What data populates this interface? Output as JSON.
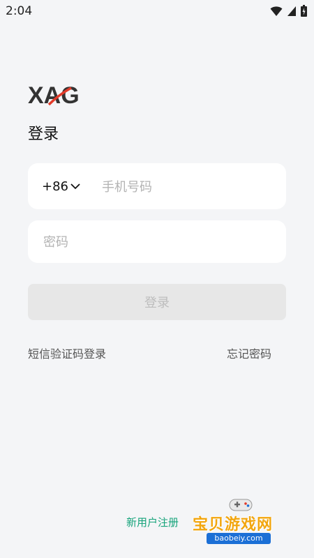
{
  "status_bar": {
    "time": "2:04",
    "icons": [
      "wifi-icon",
      "signal-icon",
      "battery-icon"
    ]
  },
  "logo": {
    "text": "XAG"
  },
  "title": "登录",
  "phone_field": {
    "country_code": "+86",
    "placeholder": "手机号码",
    "value": ""
  },
  "password_field": {
    "placeholder": "密码",
    "value": ""
  },
  "login_button": {
    "label": "登录",
    "enabled": false
  },
  "links": {
    "sms_login": "短信验证码登录",
    "forgot_password": "忘记密码",
    "register": "新用户注册"
  },
  "watermark": {
    "name": "宝贝游戏网",
    "url": "baobeiy.com"
  },
  "colors": {
    "background": "#f4f5f7",
    "accent": "#15a37a",
    "field_bg": "#ffffff",
    "button_disabled_bg": "#e7e7e7",
    "button_disabled_text": "#bdbdbd",
    "placeholder": "#b3b3b3"
  }
}
